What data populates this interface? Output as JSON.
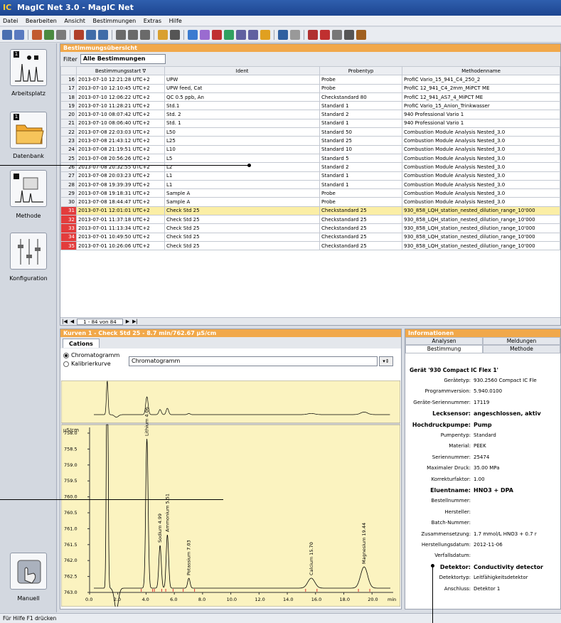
{
  "window": {
    "title": "MagIC Net 3.0 - MagIC Net",
    "logo": "IC"
  },
  "menu": [
    "Datei",
    "Bearbeiten",
    "Ansicht",
    "Bestimmungen",
    "Extras",
    "Hilfe"
  ],
  "nav": [
    {
      "label": "Arbeitsplatz",
      "num": "1"
    },
    {
      "label": "Datenbank",
      "num": "1"
    },
    {
      "label": "Methode",
      "num": ""
    },
    {
      "label": "Konfiguration",
      "num": ""
    },
    {
      "label": "Manuell",
      "num": ""
    }
  ],
  "overview": {
    "title": "Bestimmungsübersicht",
    "filter_label": "Filter",
    "filter_value": "Alle Bestimmungen",
    "columns": [
      "",
      "Bestimmungsstart ∇",
      "Ident",
      "Probentyp",
      "Methodenname"
    ],
    "rows": [
      [
        "16",
        "2013-07-10 12:21:28 UTC+2",
        "UPW",
        "Probe",
        "ProfIC Vario_15_941_C4_250_2"
      ],
      [
        "17",
        "2013-07-10 12:10:45 UTC+2",
        "UPW feed, Cat",
        "Probe",
        "ProfIC 12_941_C4_2mm_MiPCT ME"
      ],
      [
        "18",
        "2013-07-10 12:06:22 UTC+2",
        "QC 0.5 ppb, An",
        "Checkstandard 80",
        "ProfIC 12_941_AS7_4_MiPCT ME"
      ],
      [
        "19",
        "2013-07-10 11:28:21 UTC+2",
        "Std.1",
        "Standard 1",
        "ProfIC Vario_15_Anion_Trinkwasser"
      ],
      [
        "20",
        "2013-07-10 08:07:42 UTC+2",
        "Std. 2",
        "Standard 2",
        "940 Professional Vario 1"
      ],
      [
        "21",
        "2013-07-10 08:06:40 UTC+2",
        "Std. 1",
        "Standard 1",
        "940 Professional Vario 1"
      ],
      [
        "22",
        "2013-07-08 22:03:03 UTC+2",
        "L50",
        "Standard 50",
        "Combustion Module Analysis Nested_3.0"
      ],
      [
        "23",
        "2013-07-08 21:43:12 UTC+2",
        "L25",
        "Standard 25",
        "Combustion Module Analysis Nested_3.0"
      ],
      [
        "24",
        "2013-07-08 21:19:51 UTC+2",
        "L10",
        "Standard 10",
        "Combustion Module Analysis Nested_3.0"
      ],
      [
        "25",
        "2013-07-08 20:56:26 UTC+2",
        "L5",
        "Standard 5",
        "Combustion Module Analysis Nested_3.0"
      ],
      [
        "26",
        "2013-07-08 20:32:55 UTC+2",
        "L2",
        "Standard 2",
        "Combustion Module Analysis Nested_3.0"
      ],
      [
        "27",
        "2013-07-08 20:03:23 UTC+2",
        "L1",
        "Standard 1",
        "Combustion Module Analysis Nested_3.0"
      ],
      [
        "28",
        "2013-07-08 19:39:39 UTC+2",
        "L1",
        "Standard 1",
        "Combustion Module Analysis Nested_3.0"
      ],
      [
        "29",
        "2013-07-08 19:18:31 UTC+2",
        "Sample A",
        "Probe",
        "Combustion Module Analysis Nested_3.0"
      ],
      [
        "30",
        "2013-07-08 18:44:47 UTC+2",
        "Sample A",
        "Probe",
        "Combustion Module Analysis Nested_3.0"
      ],
      [
        "31",
        "2013-07-01 12:01:01 UTC+2",
        "Check Std 25",
        "Checkstandard 25",
        "930_858_LQH_station_nested_dilution_range_10'000"
      ],
      [
        "32",
        "2013-07-01 11:37:18 UTC+2",
        "Check Std 25",
        "Checkstandard 25",
        "930_858_LQH_station_nested_dilution_range_10'000"
      ],
      [
        "33",
        "2013-07-01 11:13:34 UTC+2",
        "Check Std 25",
        "Checkstandard 25",
        "930_858_LQH_station_nested_dilution_range_10'000"
      ],
      [
        "34",
        "2013-07-01 10:49:50 UTC+2",
        "Check Std 25",
        "Checkstandard 25",
        "930_858_LQH_station_nested_dilution_range_10'000"
      ],
      [
        "35",
        "2013-07-01 10:26:06 UTC+2",
        "Check Std 25",
        "Checkstandard 25",
        "930_858_LQH_station_nested_dilution_range_10'000"
      ]
    ],
    "selected_index": 15,
    "pager": "1 - 84 von 84"
  },
  "curves": {
    "title": "Kurven 1 - Check Std 25 - 8.7 min/762.67 µS/cm",
    "tab": "Cations",
    "radio1": "Chromatogramm",
    "radio2": "Kalibrierkurve",
    "dropdown": "Chromatogramm",
    "y_unit": "µS/cm",
    "x_unit": "min",
    "y_ticks": [
      "758.0",
      "758.5",
      "759.0",
      "759.5",
      "760.0",
      "760.5",
      "761.0",
      "761.5",
      "762.0",
      "762.5",
      "763.0"
    ],
    "x_ticks": [
      "0.0",
      "2.0",
      "4.0",
      "6.0",
      "8.0",
      "10.0",
      "12.0",
      "14.0",
      "16.0",
      "18.0",
      "20.0"
    ],
    "peaks": [
      {
        "name": "Lithium 4.06",
        "t": 4.06
      },
      {
        "name": "Sodium 4.99",
        "t": 4.99
      },
      {
        "name": "Ammonium 5.51",
        "t": 5.51
      },
      {
        "name": "Potassium 7.03",
        "t": 7.03
      },
      {
        "name": "Calcium 15.70",
        "t": 15.7
      },
      {
        "name": "Magnesium 19.44",
        "t": 19.44
      }
    ]
  },
  "info": {
    "title": "Informationen",
    "tabs_row1": [
      "Analysen",
      "Meldungen"
    ],
    "tabs_row2": [
      "Bestimmung",
      "Methode"
    ],
    "group": "Gerät '930 Compact IC Flex 1'",
    "items": [
      {
        "k": "Gerätetyp:",
        "v": "930.2560 Compact IC Fle",
        "b": false
      },
      {
        "k": "Programmversion:",
        "v": "5.940.0100",
        "b": false
      },
      {
        "k": "Geräte-Seriennummer:",
        "v": "17119",
        "b": false
      },
      {
        "k": "Lecksensor:",
        "v": "angeschlossen, aktiv",
        "b": true
      },
      {
        "k": "Hochdruckpumpe:",
        "v": "Pump",
        "b": true
      },
      {
        "k": "Pumpentyp:",
        "v": "Standard",
        "b": false
      },
      {
        "k": "Material:",
        "v": "PEEK",
        "b": false
      },
      {
        "k": "Seriennummer:",
        "v": "25474",
        "b": false
      },
      {
        "k": "Maximaler Druck:",
        "v": "35.00 MPa",
        "b": false
      },
      {
        "k": "Korrekturfaktor:",
        "v": "1.00",
        "b": false
      },
      {
        "k": "Eluentname:",
        "v": "HNO3 + DPA",
        "b": true
      },
      {
        "k": "Bestellnummer:",
        "v": "",
        "b": false
      },
      {
        "k": "Hersteller:",
        "v": "",
        "b": false
      },
      {
        "k": "Batch-Nummer:",
        "v": "",
        "b": false
      },
      {
        "k": "Zusammensetzung:",
        "v": "1.7 mmol/L HNO3 + 0.7 r",
        "b": false
      },
      {
        "k": "Herstellungsdatum:",
        "v": "2012-11-06",
        "b": false
      },
      {
        "k": "Verfallsdatum:",
        "v": "",
        "b": false
      },
      {
        "k": "Detektor:",
        "v": "Conductivity detector",
        "b": true
      },
      {
        "k": "Detektortyp:",
        "v": "Leitfähigkeitsdetektor",
        "b": false
      },
      {
        "k": "Anschluss:",
        "v": "Detektor 1",
        "b": false
      }
    ]
  },
  "status": "Für Hilfe F1 drücken"
}
